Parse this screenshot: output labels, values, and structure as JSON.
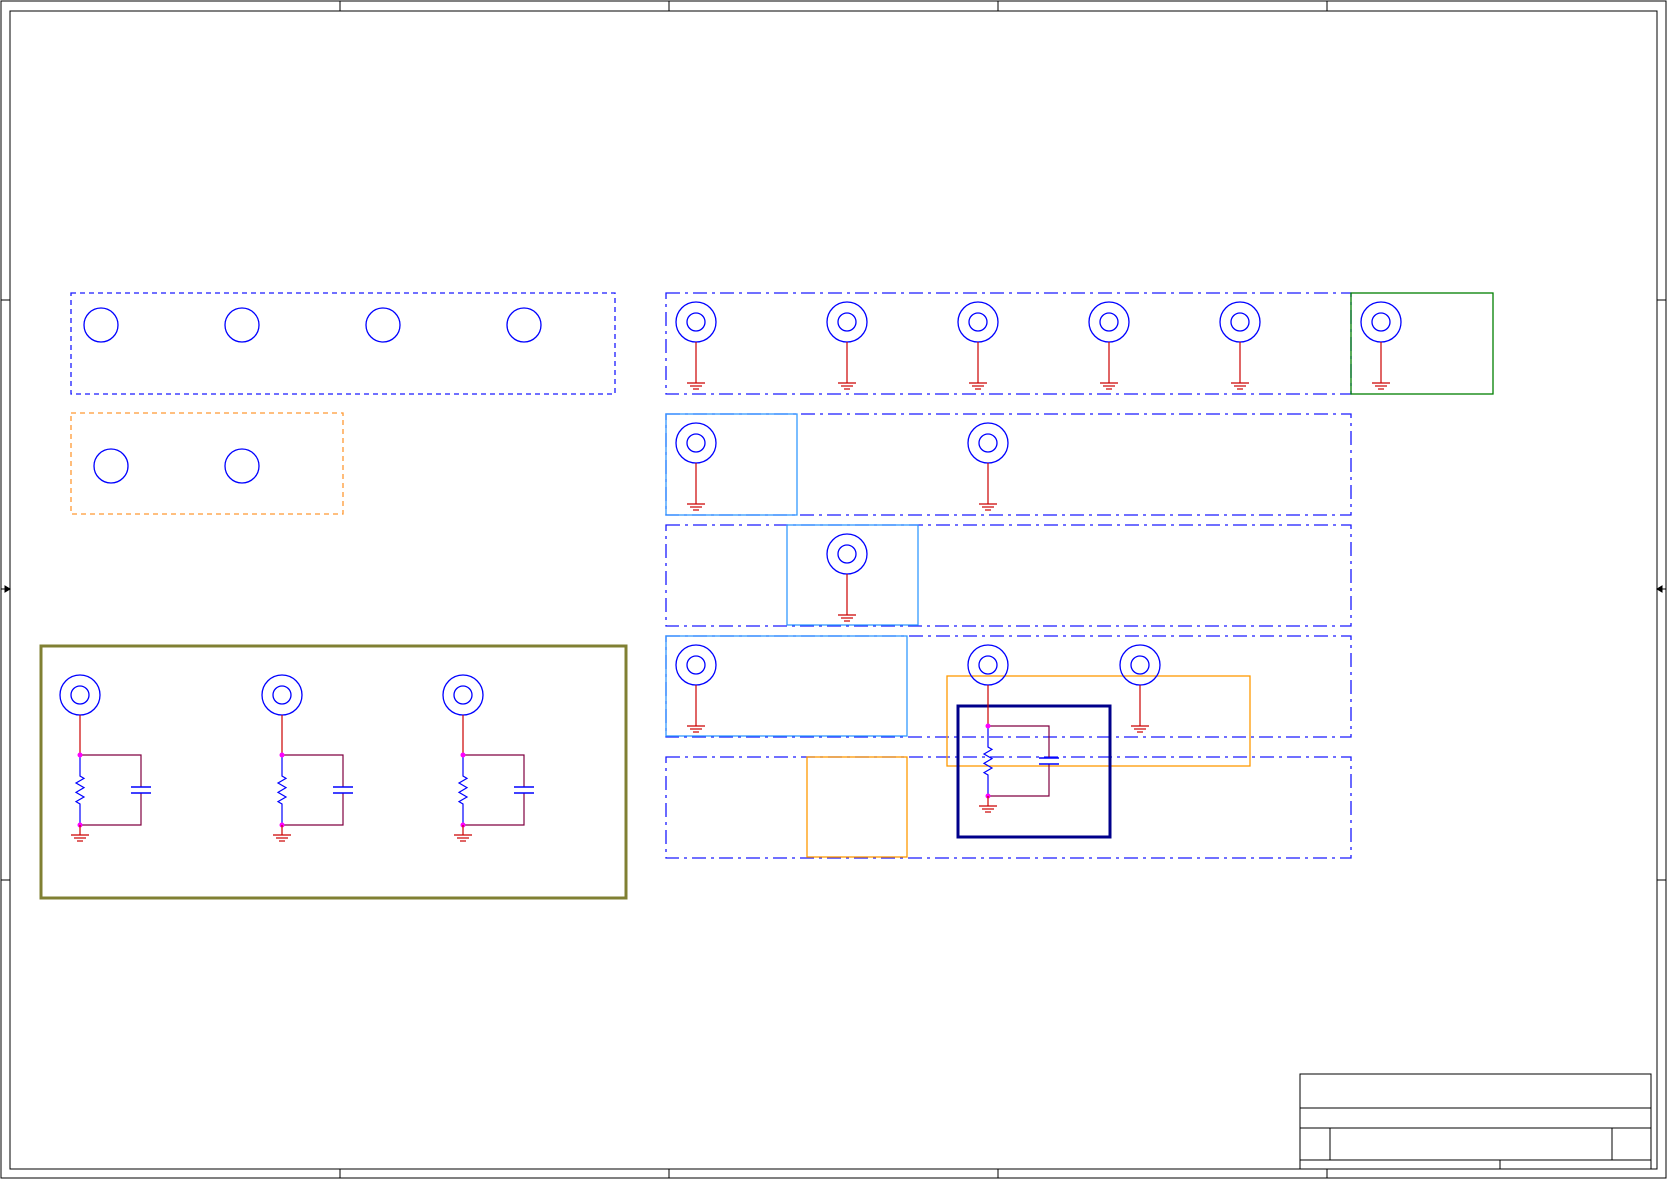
{
  "diagram": {
    "type": "schematic",
    "colors": {
      "frame": "#000000",
      "ring": "#0000ff",
      "wire": "#cc0000",
      "net": "#800040",
      "junction": "#ff00ff",
      "dash_blue": "#1a1aff",
      "dash_orange": "#ff9933",
      "box_green": "#008000",
      "box_lightblue": "#3399ff",
      "box_orange": "#ff9900",
      "box_navy": "#00008b",
      "box_olive": "#808033"
    },
    "frame_columns": 5,
    "frame_rows": 4
  }
}
